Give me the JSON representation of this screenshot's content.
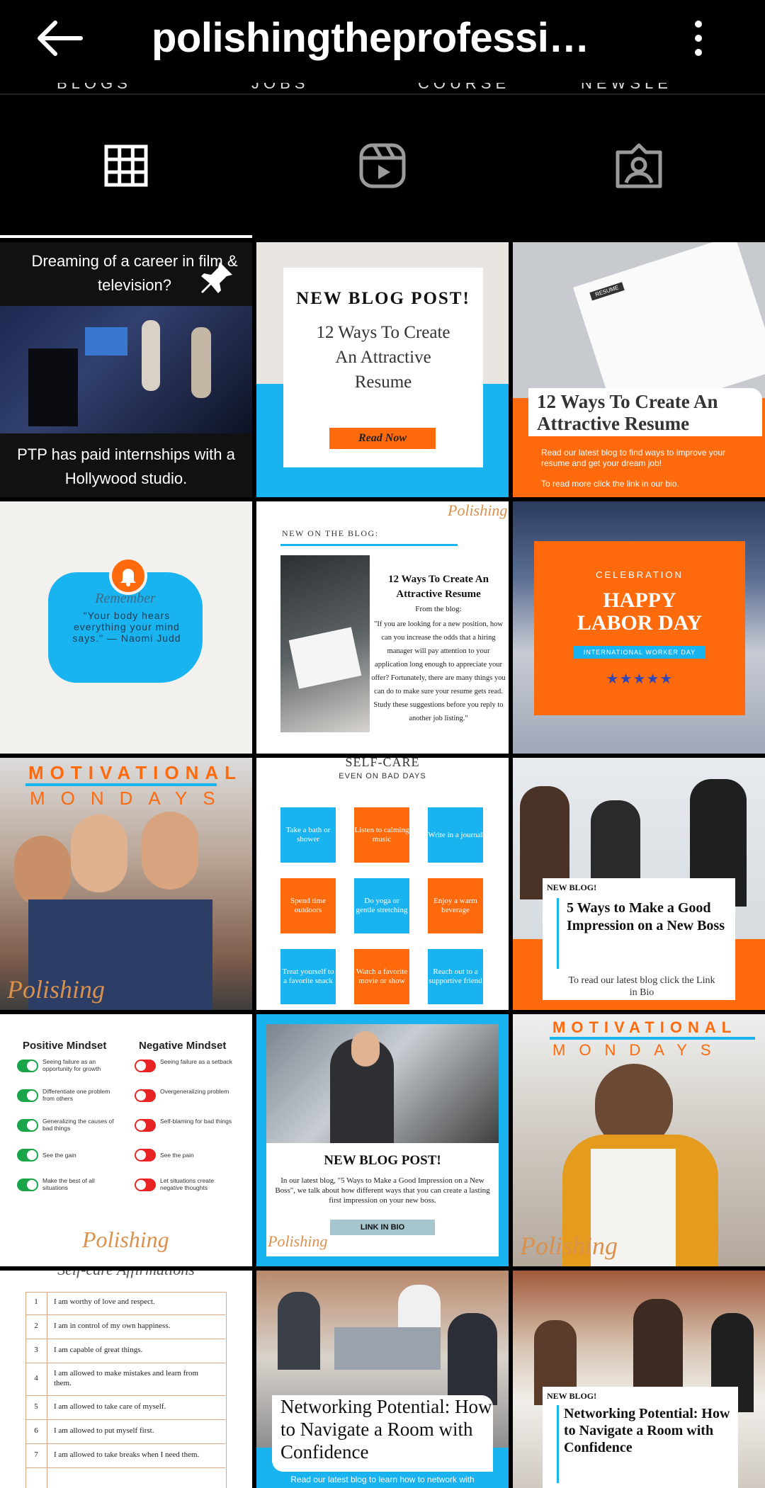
{
  "header": {
    "title": "polishingtheprofessio…",
    "back_icon": "arrow-left-icon",
    "more_icon": "more-vertical-icon"
  },
  "highlights": [
    "BLOGS",
    "JOBS",
    "COURSES",
    "NEWSLETTER"
  ],
  "tabs": [
    {
      "name": "posts",
      "icon": "grid-icon",
      "active": true
    },
    {
      "name": "reels",
      "icon": "reels-icon",
      "active": false
    },
    {
      "name": "tagged",
      "icon": "tagged-user-icon",
      "active": false
    }
  ],
  "posts": {
    "p1": {
      "top": "Dreaming of a career in film & television?",
      "bottom": "PTP has paid internships with a Hollywood studio.",
      "pinned": true
    },
    "p2": {
      "heading": "NEW BLOG POST!",
      "title": "12 Ways To Create An Attractive Resume",
      "button": "Read Now"
    },
    "p3": {
      "title": "12 Ways To Create An Attractive Resume",
      "body": "Read our latest blog to find ways to improve your resume and get your dream job!",
      "cta": "To read more click the link in our bio.",
      "doc_label": "RESUME"
    },
    "p4": {
      "script": "Remember",
      "quote": "\"Your body hears everything your mind says.\" — Naomi Judd"
    },
    "p5": {
      "logo": "Polishing",
      "label": "NEW ON THE BLOG:",
      "title": "12 Ways To Create An Attractive Resume",
      "from": "From the blog:",
      "body": "\"If you are looking for a new position, how can you increase the odds that a hiring manager will pay attention to your application long enough to appreciate your offer? Fortunately, there are many things you can do to make sure your resume gets read. Study these suggestions before you reply to another job listing.\""
    },
    "p6": {
      "kicker": "CELEBRATION",
      "title": "HAPPY LABOR DAY",
      "sub": "INTERNATIONAL WORKER DAY",
      "stars": "★★★★★"
    },
    "p7": {
      "line1": "MOTIVATIONAL",
      "line2": "MONDAYS",
      "logo": "Polishing"
    },
    "p8": {
      "title": "SELF-CARE",
      "subtitle": "EVEN ON BAD DAYS",
      "tiles": [
        "Take a bath or shower",
        "Listen to calming music",
        "Write in a journal",
        "Spend time outdoors",
        "Do yoga or gentle stretching",
        "Enjoy a warm beverage",
        "Treat yourself to a favorite snack",
        "Watch a favorite movie or show",
        "Reach out to a supportive friend"
      ]
    },
    "p9": {
      "label": "NEW BLOG!",
      "title": "5 Ways to Make a Good Impression on a New Boss",
      "cta": "To read our latest blog click the Link in Bio"
    },
    "p10": {
      "pos_title": "Positive Mindset",
      "neg_title": "Negative Mindset",
      "positive": [
        "Seeing failure as an opportunity for growth",
        "Differentiate one problem from others",
        "Generalizing the causes of bad things",
        "See the gain",
        "Make the best of all situations"
      ],
      "negative": [
        "Seeing failure as a setback",
        "Overgeneralizing problem",
        "Self-blaming for bad things",
        "See the pain",
        "Let situations create negative thoughts"
      ],
      "logo": "Polishing"
    },
    "p11": {
      "heading": "NEW BLOG POST!",
      "body": "In our latest blog, \"5 Ways to Make a Good Impression on a New Boss\", we talk about how different ways that you can create a lasting first impression on your new boss.",
      "button": "LINK IN BIO",
      "logo": "Polishing"
    },
    "p12": {
      "line1": "MOTIVATIONAL",
      "line2": "MONDAYS",
      "logo": "Polishing"
    },
    "p13": {
      "title": "Self-care Affirmations",
      "rows": [
        [
          "1",
          "I am worthy of love and respect."
        ],
        [
          "2",
          "I am in control of my own happiness."
        ],
        [
          "3",
          "I am capable of great things."
        ],
        [
          "4",
          "I am allowed to make mistakes and learn from them."
        ],
        [
          "5",
          "I am allowed to take care of myself."
        ],
        [
          "6",
          "I am allowed to put myself first."
        ],
        [
          "7",
          "I am allowed to take breaks when I need them."
        ]
      ]
    },
    "p14": {
      "title": "Networking Potential: How to Navigate a Room with Confidence",
      "body": "Read our latest blog to learn how to network with"
    },
    "p15": {
      "label": "NEW BLOG!",
      "title": "Networking Potential: How to Navigate a Room with Confidence"
    }
  },
  "colors": {
    "blue": "#19b3f0",
    "orange": "#ff6a0d",
    "bg": "#000000"
  }
}
